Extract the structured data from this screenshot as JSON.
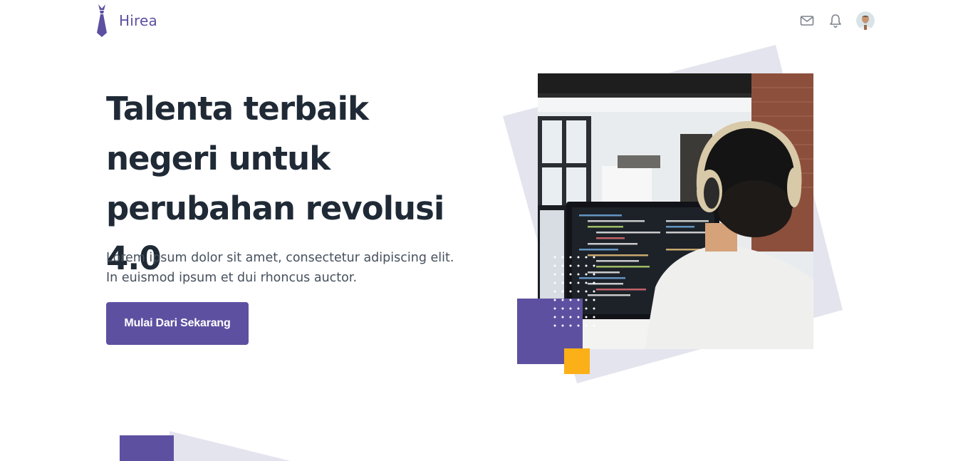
{
  "brand": {
    "name": "Hirea",
    "logo_icon": "tie-icon",
    "color": "#5E50A1"
  },
  "nav": {
    "icons": [
      "mail-icon",
      "bell-icon",
      "avatar"
    ]
  },
  "hero": {
    "title": "Talenta terbaik negeri untuk perubahan revolusi 4.0",
    "description": "Lorem ipsum dolor sit amet, consectetur adipiscing elit. In euismod ipsum et dui rhoncus auctor.",
    "cta_label": "Mulai Dari Sekarang",
    "image": "developer-with-headphones-photo"
  },
  "colors": {
    "primary": "#5E50A1",
    "accent": "#FBB017",
    "shape": "#E2E2EC",
    "heading": "#1F2A36",
    "text": "#46505C"
  }
}
